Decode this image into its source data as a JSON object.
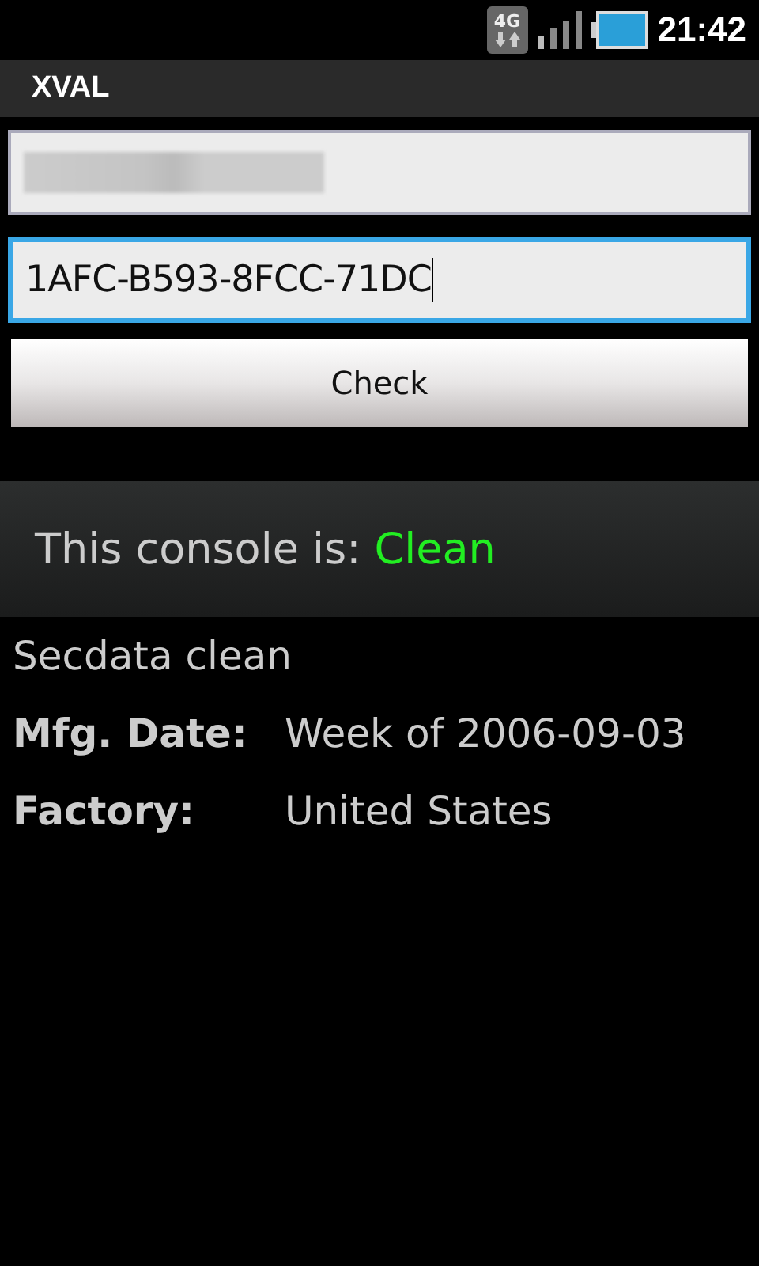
{
  "status_bar": {
    "network": "4G",
    "time": "21:42"
  },
  "title_bar": {
    "title": "XVAL"
  },
  "fields": [
    {
      "kind": "redacted",
      "focused": false
    },
    {
      "kind": "text",
      "value": "1AFC-B593-8FCC-71DC",
      "focused": true
    }
  ],
  "check_button": {
    "label": "Check"
  },
  "result": {
    "label": "This console is:",
    "status": "Clean",
    "color": "#22ee22"
  },
  "details": [
    {
      "kind": "line",
      "text": "Secdata clean"
    },
    {
      "kind": "pair",
      "label": "Mfg. Date:",
      "value": "Week of 2006-09-03"
    },
    {
      "kind": "pair",
      "label": "Factory:",
      "value": "United States"
    }
  ]
}
